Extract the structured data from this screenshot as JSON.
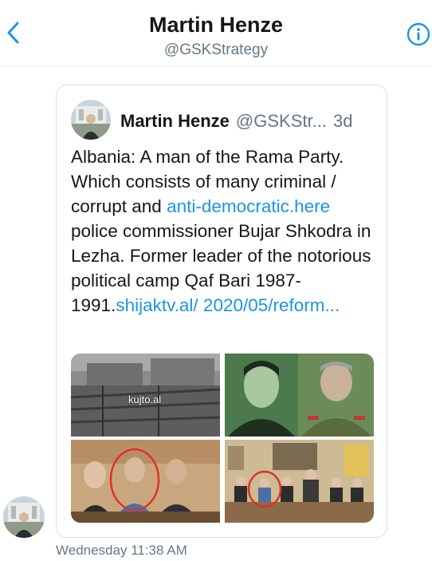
{
  "header": {
    "title": "Martin Henze",
    "handle": "@GSKStrategy",
    "back_icon": "chevron-left-icon",
    "info_icon": "info-icon"
  },
  "colors": {
    "accent": "#1b95e0",
    "secondary_text": "#657786",
    "border": "#e6ecf0"
  },
  "tweet": {
    "author_name": "Martin Henze",
    "author_handle": "@GSKStr...",
    "time": "3d",
    "text_parts": {
      "p1": "Albania: A man of the Rama Party. Which consists of many criminal / corrupt and ",
      "link1": "anti-democratic.here",
      "p2": " police commissioner Bujar Shkodra in Lezha. Former leader of the notorious political camp Qaf Bari 1987-1991.",
      "link2": "shijaktv.al/ 2020/05/reform..."
    },
    "images": [
      {
        "watermark": "kujto.al"
      },
      {},
      {},
      {}
    ]
  },
  "message": {
    "timestamp": "Wednesday 11:38 AM"
  }
}
